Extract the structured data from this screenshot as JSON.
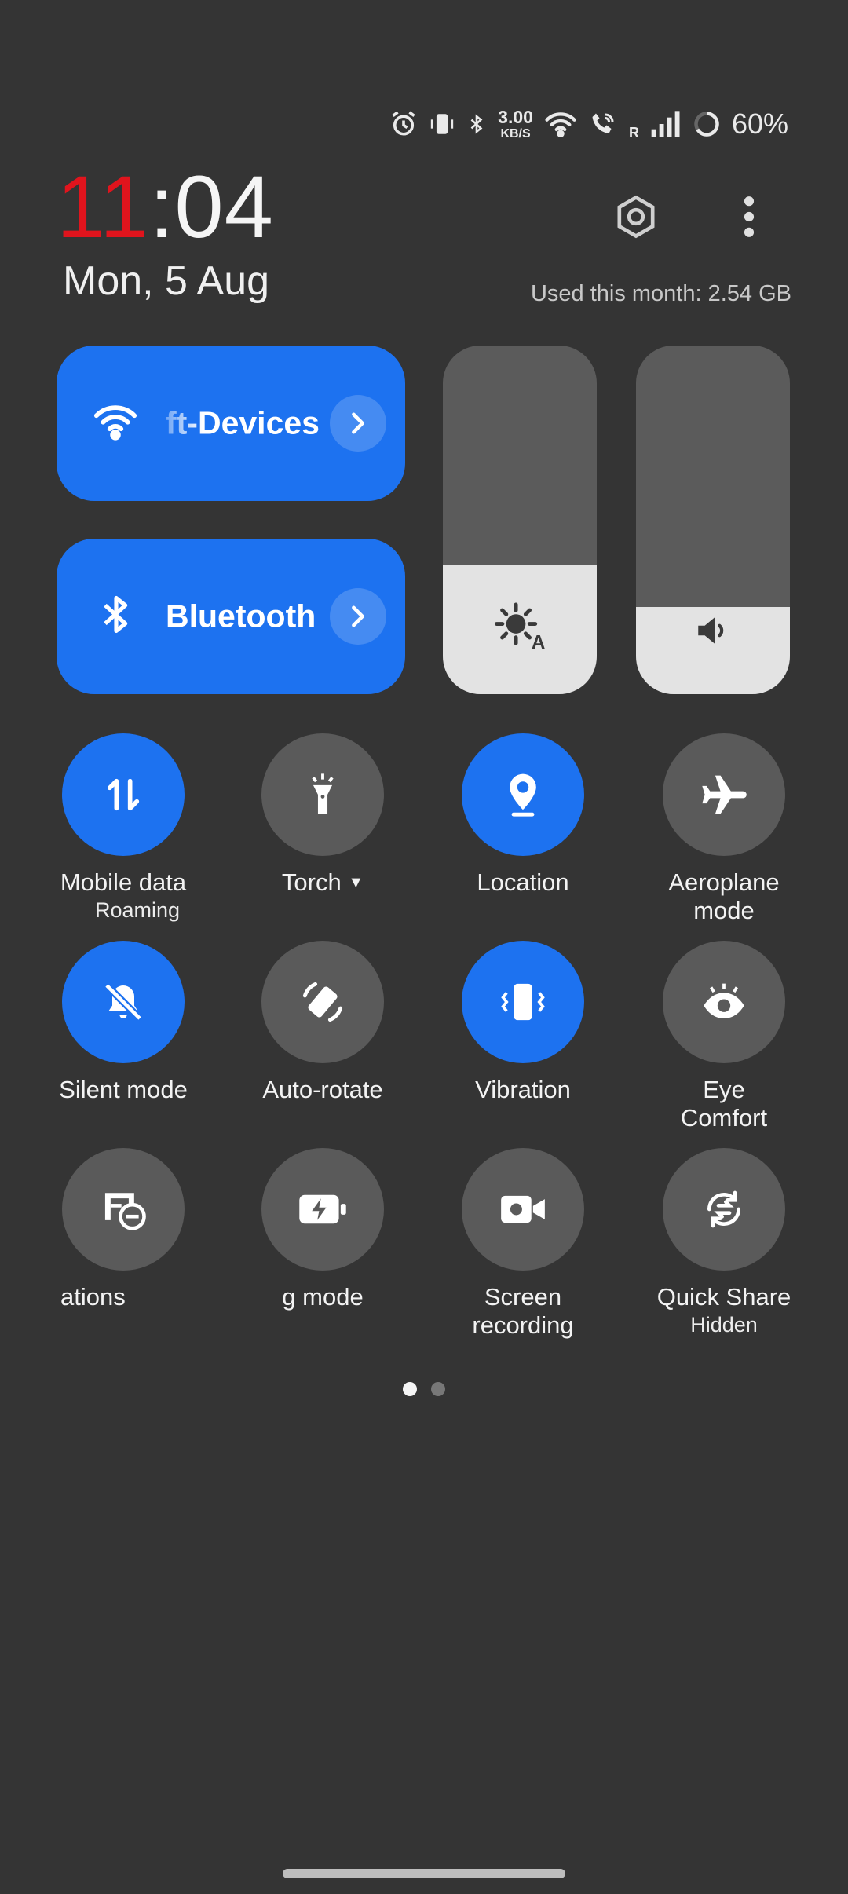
{
  "status_bar": {
    "net_speed_value": "3.00",
    "net_speed_unit": "KB/S",
    "roaming_indicator": "R",
    "battery_percent": "60%",
    "icons": [
      "alarm-icon",
      "vibrate-icon",
      "bluetooth-icon",
      "wifi-icon",
      "wifi-calling-icon",
      "signal-icon",
      "battery-ring-icon"
    ]
  },
  "clock": {
    "hour": "11",
    "minute": ":04"
  },
  "date": "Mon, 5 Aug",
  "data_usage": "Used this month: 2.54 GB",
  "tiles_wide": {
    "wifi": {
      "label": "ft-Devices",
      "icon": "wifi-icon"
    },
    "bluetooth": {
      "label": "Bluetooth",
      "icon": "bluetooth-icon"
    }
  },
  "sliders": {
    "brightness": {
      "level": 0.37,
      "icon": "auto-brightness-icon",
      "auto_badge": "A"
    },
    "volume": {
      "level": 0.25,
      "icon": "speaker-icon"
    }
  },
  "toggles": [
    {
      "label": "Mobile data",
      "sub": "Roaming",
      "state": "on",
      "icon": "mobile-data-icon"
    },
    {
      "label": "Torch",
      "sub": "",
      "state": "off",
      "icon": "torch-icon"
    },
    {
      "label": "Location",
      "sub": "",
      "state": "on",
      "icon": "location-icon"
    },
    {
      "label": "Aeroplane",
      "sub": "mode",
      "state": "off",
      "icon": "airplane-icon"
    },
    {
      "label": "Silent mode",
      "sub": "",
      "state": "on",
      "icon": "silent-bell-icon"
    },
    {
      "label": "Auto-rotate",
      "sub": "",
      "state": "off",
      "icon": "auto-rotate-icon"
    },
    {
      "label": "Vibration",
      "sub": "",
      "state": "on",
      "icon": "vibration-icon"
    },
    {
      "label": "Eye",
      "sub": "Comfort",
      "state": "off",
      "icon": "eye-icon"
    },
    {
      "label": "ations",
      "sub": "",
      "state": "off",
      "icon": "notifications-blocked-icon"
    },
    {
      "label": "g mode",
      "sub": "",
      "state": "off",
      "icon": "battery-saver-icon"
    },
    {
      "label": "Screen",
      "sub": "recording",
      "state": "off",
      "icon": "screen-record-icon"
    },
    {
      "label": "Quick Share",
      "sub": "Hidden",
      "state": "off",
      "icon": "quick-share-icon"
    }
  ],
  "pagination": {
    "pages": 2,
    "current": 1
  },
  "colors": {
    "accent": "#1d72f0",
    "clock_hour": "#e0141d",
    "background": "#343434"
  }
}
